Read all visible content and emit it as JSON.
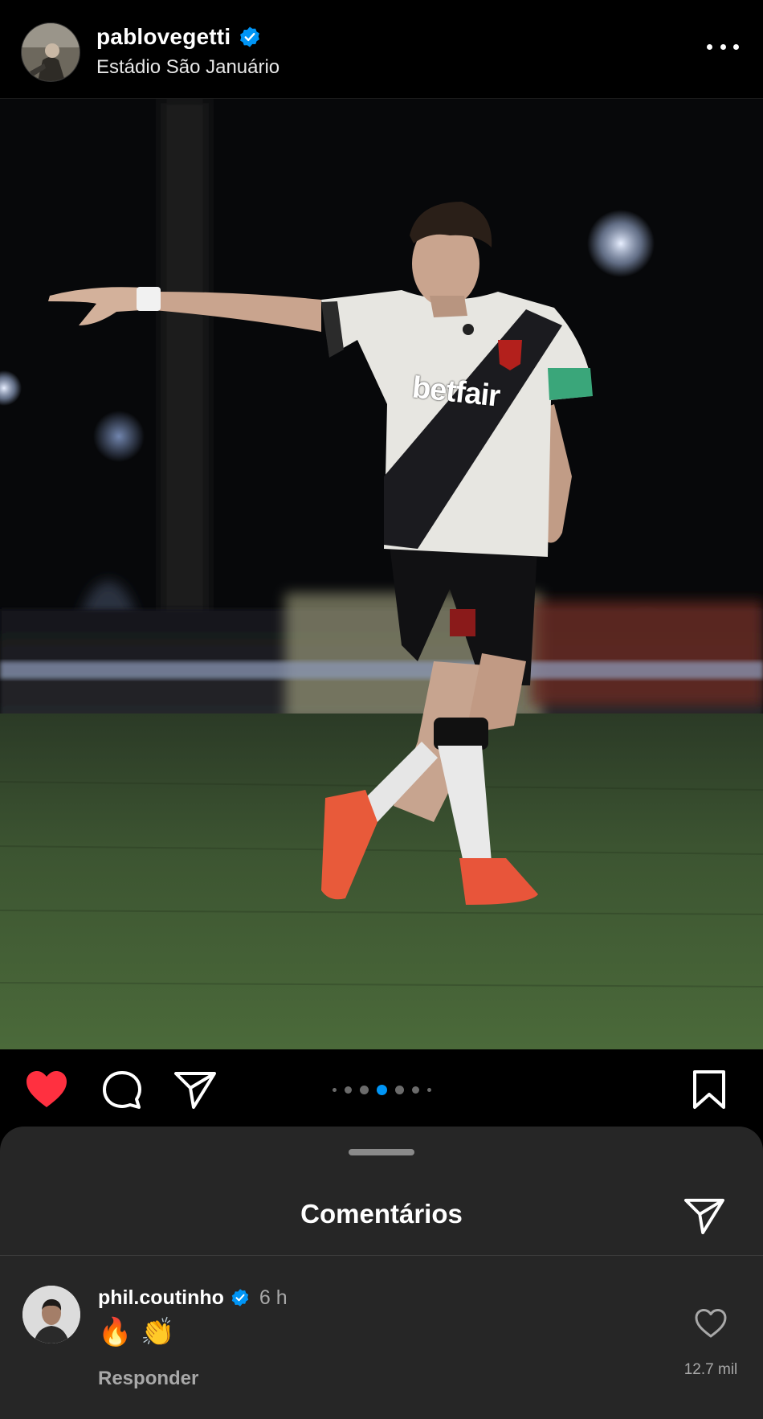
{
  "post": {
    "username": "pablovegetti",
    "verified": true,
    "location": "Estádio São Januário",
    "more_icon": "more-horizontal-icon"
  },
  "photo": {
    "jersey_sponsor": "betfair"
  },
  "actions": {
    "liked": true,
    "like_color": "#ff3040",
    "carousel_total": 7,
    "carousel_active_index": 3
  },
  "comments_sheet": {
    "title": "Comentários",
    "comments": [
      {
        "username": "phil.coutinho",
        "verified": true,
        "time": "6 h",
        "text": "🔥 👏",
        "reply_label": "Responder",
        "like_count": "12.7 mil"
      }
    ]
  },
  "colors": {
    "background": "#000000",
    "sheet": "#262626",
    "verified_badge": "#0095f6",
    "secondary_text": "#a8a8a8"
  }
}
